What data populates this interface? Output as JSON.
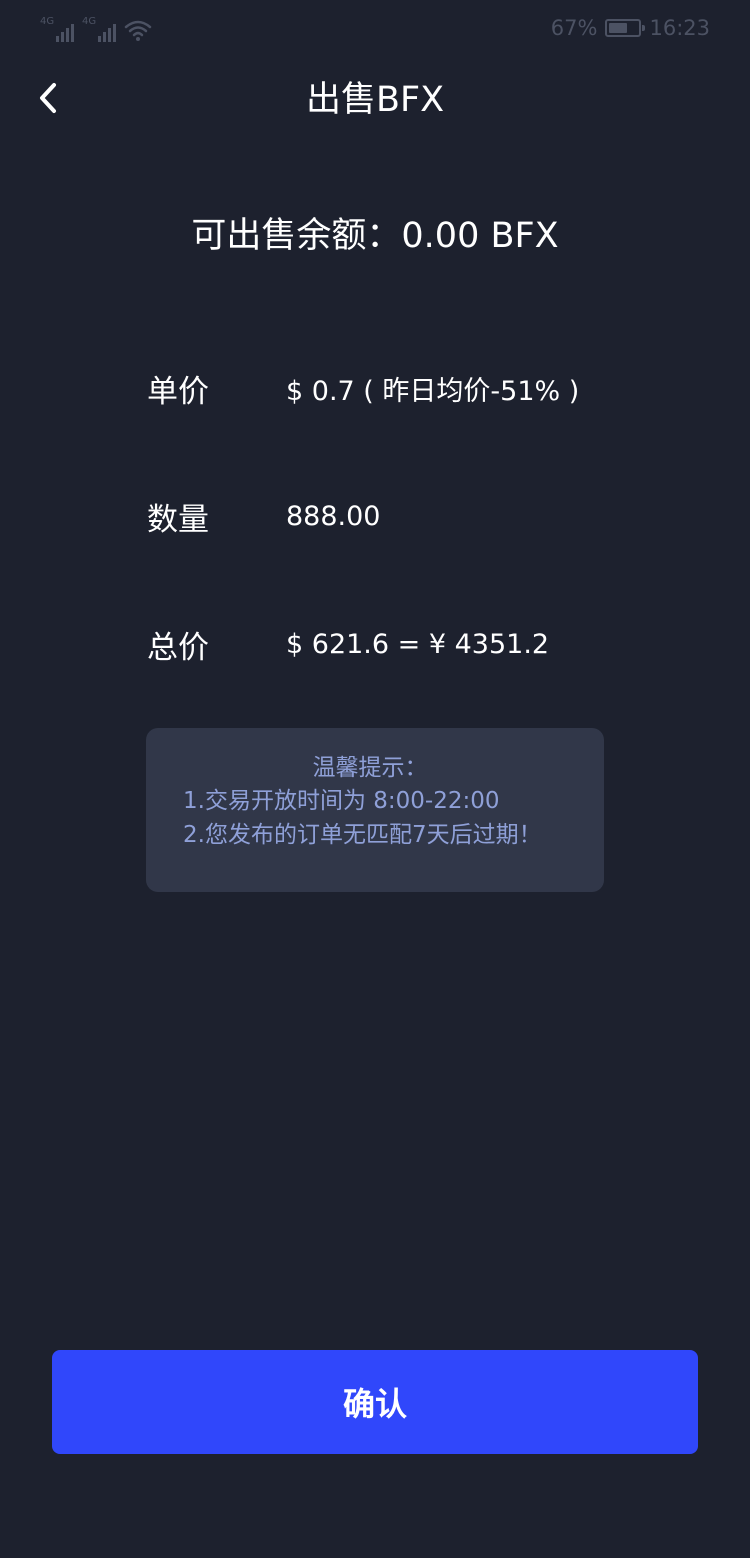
{
  "status_bar": {
    "signal_1_tag": "4G",
    "signal_2_tag": "4G",
    "battery_percent": "67%",
    "battery_level": 0.67,
    "time": "16:23",
    "icon_color": "#4c5263"
  },
  "nav": {
    "back_icon": "chevron-left-icon",
    "title": "出售BFX"
  },
  "balance": {
    "text": "可出售余额：0.00 BFX"
  },
  "rows": {
    "price": {
      "label": "单价",
      "value": "$ 0.7 ( 昨日均价-51% )"
    },
    "quantity": {
      "label": "数量",
      "value": "888.00"
    },
    "total": {
      "label": "总价",
      "value": "$ 621.6  =  ¥ 4351.2"
    }
  },
  "tips": {
    "title": "温馨提示：",
    "line_1": "1.交易开放时间为 8:00-22:00",
    "line_2": "2.您发布的订单无匹配7天后过期！"
  },
  "confirm_button": {
    "label": "确认"
  },
  "colors": {
    "background": "#1d212e",
    "card": "#313749",
    "tip_text": "#8fa0d8",
    "accent": "#3047fb"
  }
}
